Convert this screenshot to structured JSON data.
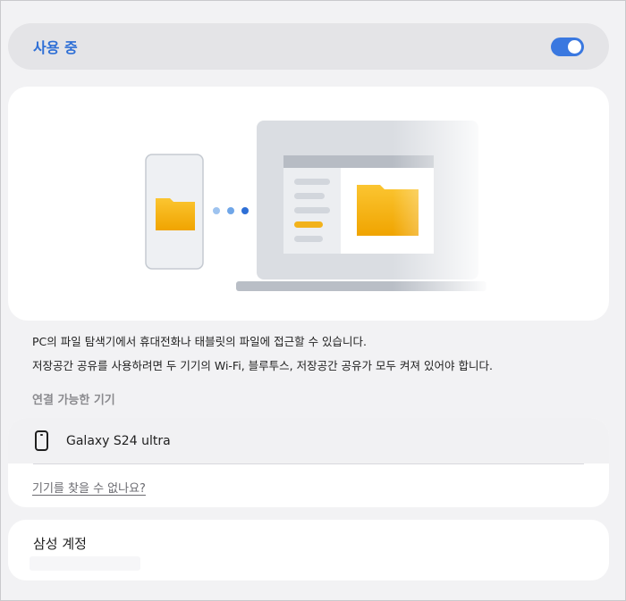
{
  "usage": {
    "label": "사용 중",
    "enabled": true
  },
  "illustration": {
    "accent_folder": "#f2b21b",
    "accent_dots": "#2e6fd6"
  },
  "description": {
    "line1": "PC의 파일 탐색기에서 휴대전화나 태블릿의 파일에 접근할 수 있습니다.",
    "line2": "저장공간 공유를 사용하려면 두 기기의 Wi-Fi, 블루투스, 저장공간 공유가 모두 켜져 있어야 합니다."
  },
  "available_devices": {
    "title": "연결 가능한 기기",
    "devices": [
      {
        "name": "Galaxy S24 ultra"
      }
    ],
    "cant_find_link": "기기를 찾을 수 없나요?"
  },
  "account": {
    "title": "삼성 계정"
  }
}
